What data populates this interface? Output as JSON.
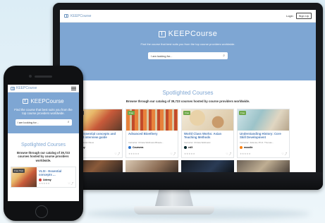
{
  "brand": {
    "logo_text": "KEEPCourse",
    "accent": "#7ea6d3"
  },
  "desktop": {
    "nav": {
      "login": "Login",
      "signup": "Sign Up"
    },
    "hero": {
      "tagline": "Find the course that best suits you from the top course providers worldwide.",
      "search_placeholder": "I am looking for..."
    },
    "section": {
      "title": "Spotlighted Courses",
      "subtitle": "Browse through our catalog of 39,723 courses hosted by course providers worldwide."
    },
    "cards": [
      {
        "badge": "Free Trial",
        "title": "VLSI - Essential concepts and detailed interview guide",
        "author": "Instructor: Sivan Nkosi",
        "provider": "Udemy",
        "provider_color": "#d43f3a",
        "stars": "★★★★★",
        "actions": "♡ ⤴"
      },
      {
        "badge": "Free",
        "title": "Advanced Bioethery",
        "author": "Instructor: Christa Wellmeist Bhaule...",
        "provider": "Coursera",
        "provider_color": "#2a73cc",
        "stars": "★★★★★",
        "actions": "♡ ⤴"
      },
      {
        "badge": "Free",
        "title": "World Class Works: Asian Teaching Methods",
        "author": "Instructor: Christa Wellmeist",
        "provider": "edX",
        "provider_color": "#02262b",
        "stars": "★★★★★",
        "actions": "♡ ⤴"
      },
      {
        "badge": "Free",
        "title": "Understanding History: Core Skill Development",
        "author": "Instructor: Julia Ha, Ph.D. Thomas...",
        "provider": "moodle",
        "provider_color": "#f98012",
        "stars": "★★★★★",
        "actions": "♡ ⤴"
      }
    ]
  },
  "mobile": {
    "hero": {
      "tagline": "Find the course that best suits you from the top course providers worldwide.",
      "search_placeholder": "I am looking for..."
    },
    "section": {
      "title": "Spotlighted Courses",
      "subtitle": "Browse through our catalog of 39,723 courses hosted by course providers worldwide."
    },
    "card": {
      "badge": "Free Trial",
      "title": "VLSI - Essential concepts ...",
      "provider": "Udemy",
      "provider_color": "#d43f3a",
      "stars": "★★★★★",
      "actions": "♡ ⤴"
    }
  }
}
